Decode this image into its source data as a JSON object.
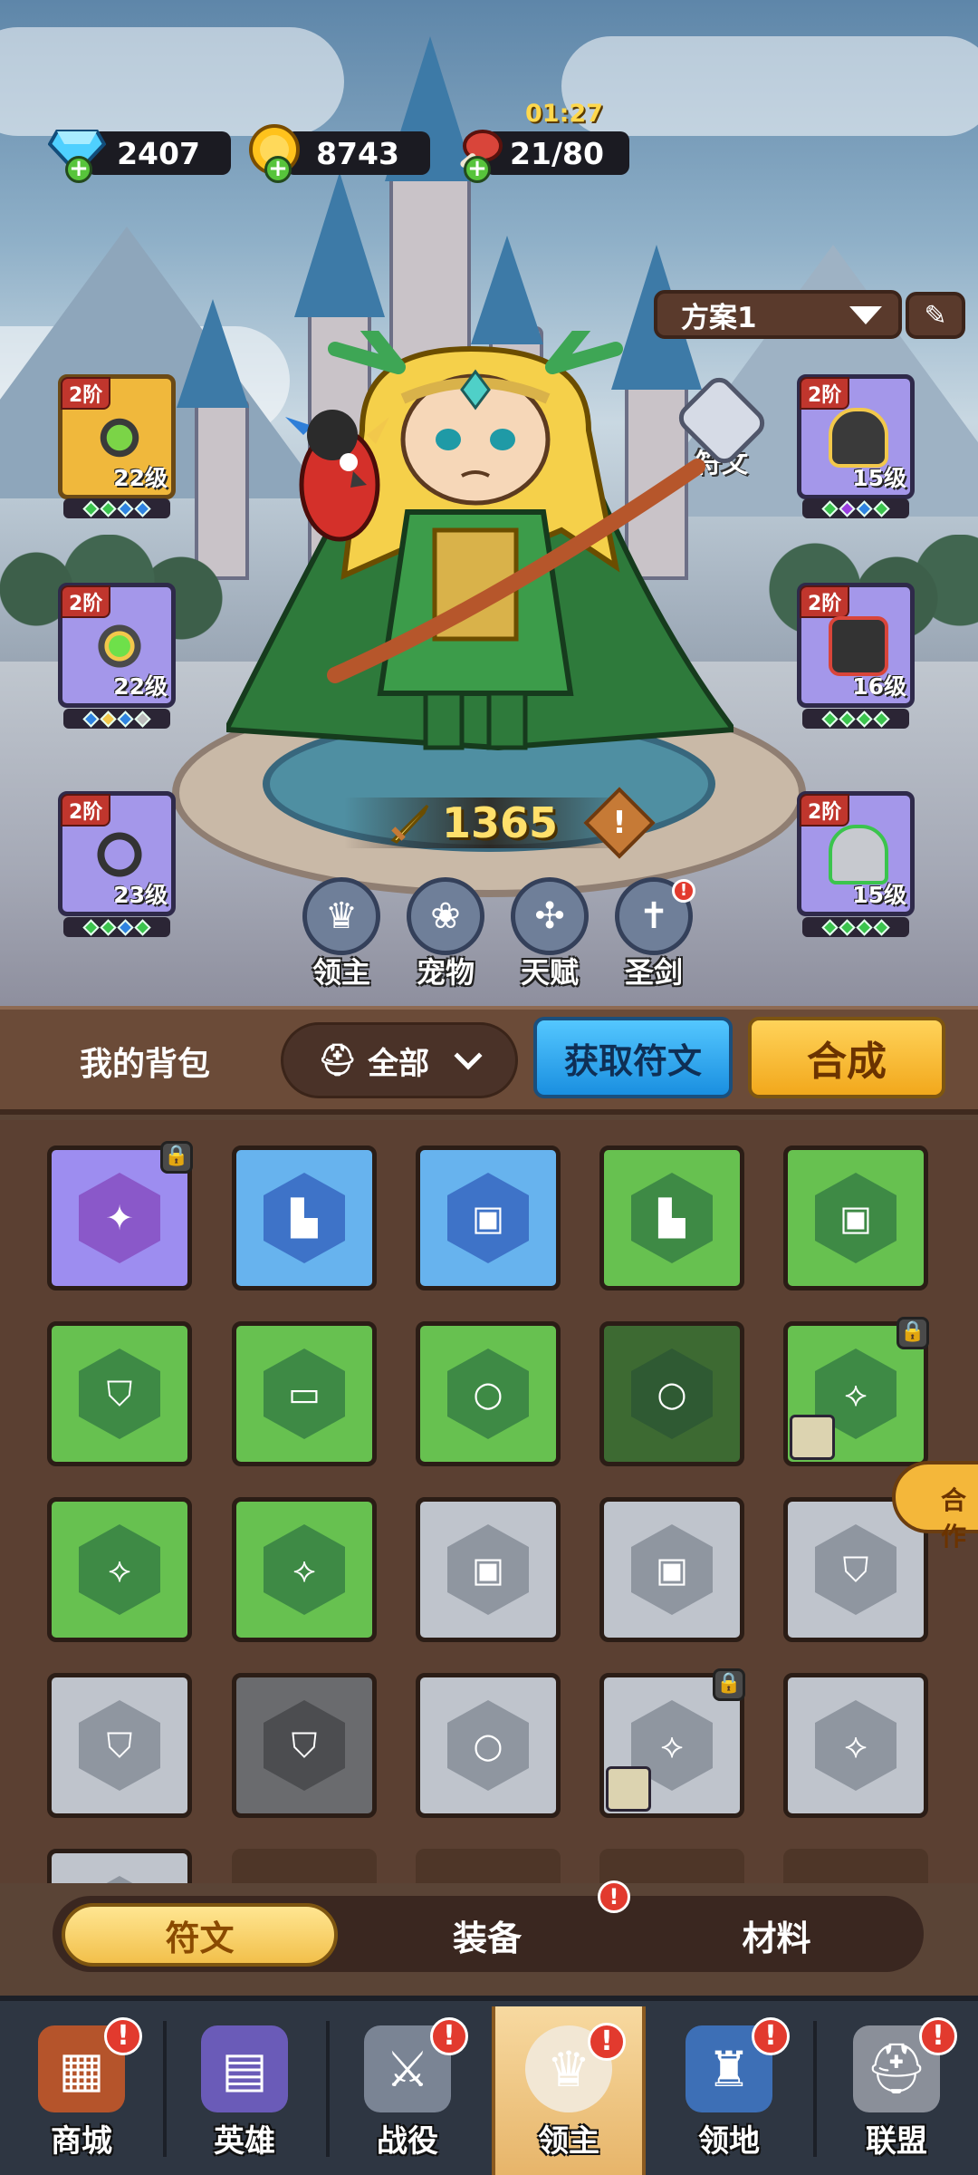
{
  "currency": {
    "diamonds": "2407",
    "gold": "8743",
    "stamina": "21/80",
    "stamina_timer": "01:27"
  },
  "plan": {
    "label": "方案1"
  },
  "equipment": {
    "left": [
      {
        "tier": "2阶",
        "level": "22级",
        "item": "necklace-icon"
      },
      {
        "tier": "2阶",
        "level": "22级",
        "item": "ring-gem-icon"
      },
      {
        "tier": "2阶",
        "level": "23级",
        "item": "ring-band-icon"
      }
    ],
    "right": [
      {
        "tier": "2阶",
        "level": "15级",
        "item": "helmet-icon"
      },
      {
        "tier": "2阶",
        "level": "16级",
        "item": "armor-icon"
      },
      {
        "tier": "2阶",
        "level": "15级",
        "item": "boots-icon"
      }
    ]
  },
  "rune_button": {
    "label": "符文"
  },
  "power": {
    "value": "1365"
  },
  "lord_menu": [
    {
      "label": "领主"
    },
    {
      "label": "宠物"
    },
    {
      "label": "天赋"
    },
    {
      "label": "圣剑"
    }
  ],
  "bag": {
    "title": "我的背包",
    "filter": "全部",
    "get_runes": "获取符文",
    "combine": "合成",
    "side_tab": "合作"
  },
  "segments": {
    "runes": "符文",
    "equipment": "装备",
    "materials": "材料"
  },
  "nav": [
    {
      "label": "商城"
    },
    {
      "label": "英雄"
    },
    {
      "label": "战役"
    },
    {
      "label": "领主"
    },
    {
      "label": "领地"
    },
    {
      "label": "联盟"
    }
  ],
  "colors": {
    "active_tab": "#f2c04b",
    "badge": "#e23a2e",
    "accent_blue": "#1a8fe0"
  }
}
